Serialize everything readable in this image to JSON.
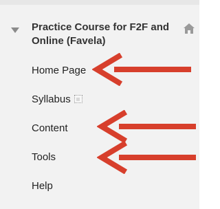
{
  "colors": {
    "panel_background": "#f2f2f2",
    "text": "#222222",
    "arrow": "#d73f2c",
    "icon": "#8a8a8a"
  },
  "course": {
    "collapse_icon": "triangle-down-icon",
    "title": "Practice Course for F2F and Online (Favela)",
    "home_icon": "home-icon"
  },
  "menu": {
    "items": [
      {
        "label": "Home Page"
      },
      {
        "label": "Syllabus",
        "icon": "file-link-icon"
      },
      {
        "label": "Content"
      },
      {
        "label": "Tools"
      },
      {
        "label": "Help"
      }
    ]
  },
  "annotations": {
    "arrow_icon": "red-arrow-icon",
    "pointed_items": [
      "Home Page",
      "Content",
      "Tools"
    ]
  }
}
